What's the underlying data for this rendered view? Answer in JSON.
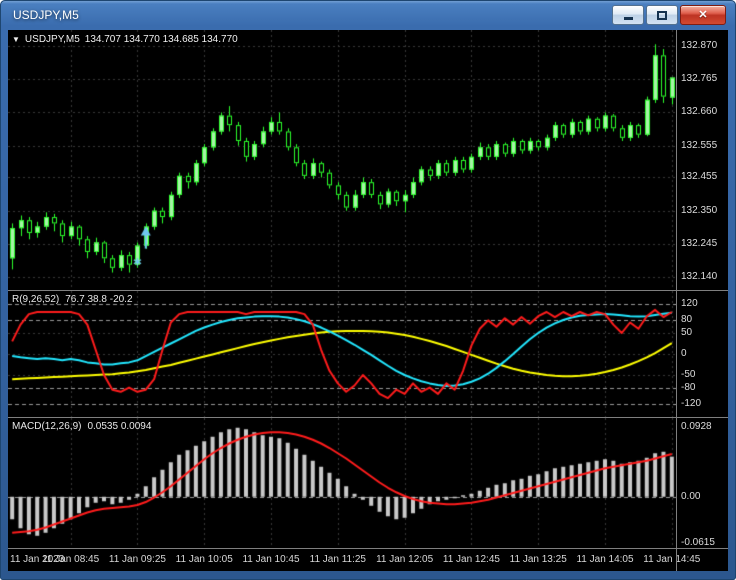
{
  "window": {
    "title": "USDJPY,M5",
    "controls": {
      "close_glyph": "✕"
    }
  },
  "quote_bar": {
    "dropdown_icon": "▼",
    "symbol": "USDJPY,M5",
    "ohlc": "134.707 134.770 134.685 134.770"
  },
  "panels": {
    "price": {
      "scale": [
        "132.870",
        "132.765",
        "132.660",
        "132.555",
        "132.455",
        "132.350",
        "132.245",
        "132.140"
      ]
    },
    "oscillator": {
      "label_name": "R(9,26,52)",
      "label_values": "76.7 38.8 -20.2",
      "scale": [
        "120",
        "80",
        "50",
        "0",
        "-50",
        "-80",
        "-120"
      ]
    },
    "macd": {
      "label_name": "MACD(12,26,9)",
      "label_values": "0.0535 0.0094",
      "scale": [
        "0.0928",
        "0.00",
        "-0.0615"
      ]
    }
  },
  "time_axis": [
    {
      "label": "11 Jan 2023",
      "index": 0
    },
    {
      "label": "11 Jan 08:45",
      "index": 7
    },
    {
      "label": "11 Jan 09:25",
      "index": 15
    },
    {
      "label": "11 Jan 10:05",
      "index": 23
    },
    {
      "label": "11 Jan 10:45",
      "index": 31
    },
    {
      "label": "11 Jan 11:25",
      "index": 39
    },
    {
      "label": "11 Jan 12:05",
      "index": 47
    },
    {
      "label": "11 Jan 12:45",
      "index": 55
    },
    {
      "label": "11 Jan 13:25",
      "index": 63
    },
    {
      "label": "11 Jan 14:05",
      "index": 71
    },
    {
      "label": "11 Jan 14:45",
      "index": 79
    }
  ],
  "colors": {
    "background": "#000000",
    "frame_blue": "#3a6cae",
    "candle_outline": "#2bff2b",
    "bull_fill": "#a7f3a7",
    "bear_fill": "#000000",
    "grid": "#383838",
    "level": "#9a9a9a",
    "separator": "#7f7f7f",
    "axis_text": "#dcdcdc",
    "annotation": "#6fc7f0"
  },
  "chart_data": [
    {
      "type": "candlestick",
      "title": "USDJPY,M5",
      "timeframe": "M5",
      "ylim": [
        132.1,
        132.92
      ],
      "y_ticks": [
        132.87,
        132.765,
        132.66,
        132.555,
        132.455,
        132.35,
        132.245,
        132.14
      ],
      "candles": [
        [
          132.2,
          132.31,
          132.165,
          132.295
        ],
        [
          132.295,
          132.335,
          132.27,
          132.32
        ],
        [
          132.32,
          132.33,
          132.26,
          132.28
        ],
        [
          132.28,
          132.315,
          132.265,
          132.3
        ],
        [
          132.3,
          132.345,
          132.29,
          132.33
        ],
        [
          132.33,
          132.34,
          132.285,
          132.31
        ],
        [
          132.31,
          132.32,
          132.25,
          132.27
        ],
        [
          132.27,
          132.315,
          132.26,
          132.3
        ],
        [
          132.3,
          132.305,
          132.24,
          132.26
        ],
        [
          132.26,
          132.27,
          132.2,
          132.22
        ],
        [
          132.22,
          132.265,
          132.21,
          132.25
        ],
        [
          132.25,
          132.255,
          132.185,
          132.2
        ],
        [
          132.2,
          132.21,
          132.155,
          132.17
        ],
        [
          132.17,
          132.225,
          132.16,
          132.21
        ],
        [
          132.21,
          132.22,
          132.155,
          132.18
        ],
        [
          132.18,
          132.25,
          132.17,
          132.24
        ],
        [
          132.24,
          132.31,
          132.23,
          132.3
        ],
        [
          132.3,
          132.36,
          132.29,
          132.35
        ],
        [
          132.35,
          132.36,
          132.31,
          132.33
        ],
        [
          132.33,
          132.41,
          132.32,
          132.4
        ],
        [
          132.4,
          132.47,
          132.39,
          132.46
        ],
        [
          132.46,
          132.47,
          132.42,
          132.44
        ],
        [
          132.44,
          132.51,
          132.43,
          132.5
        ],
        [
          132.5,
          132.56,
          132.49,
          132.55
        ],
        [
          132.55,
          132.61,
          132.54,
          132.6
        ],
        [
          132.6,
          132.66,
          132.59,
          132.65
        ],
        [
          132.65,
          132.68,
          132.6,
          132.62
        ],
        [
          132.62,
          132.63,
          132.555,
          132.57
        ],
        [
          132.57,
          132.58,
          132.505,
          132.52
        ],
        [
          132.52,
          132.57,
          132.51,
          132.56
        ],
        [
          132.56,
          132.615,
          132.55,
          132.6
        ],
        [
          132.6,
          132.645,
          132.59,
          132.63
        ],
        [
          132.63,
          132.66,
          132.59,
          132.6
        ],
        [
          132.6,
          132.61,
          132.54,
          132.55
        ],
        [
          132.55,
          132.56,
          132.49,
          132.5
        ],
        [
          132.5,
          132.51,
          132.45,
          132.46
        ],
        [
          132.46,
          132.515,
          132.45,
          132.5
        ],
        [
          132.5,
          132.505,
          132.455,
          132.47
        ],
        [
          132.47,
          132.48,
          132.42,
          132.43
        ],
        [
          132.43,
          132.44,
          132.385,
          132.4
        ],
        [
          132.4,
          132.41,
          132.35,
          132.36
        ],
        [
          132.36,
          132.415,
          132.35,
          132.4
        ],
        [
          132.4,
          132.455,
          132.39,
          132.44
        ],
        [
          132.44,
          132.45,
          132.39,
          132.4
        ],
        [
          132.4,
          132.41,
          132.355,
          132.37
        ],
        [
          132.37,
          132.42,
          132.36,
          132.41
        ],
        [
          132.41,
          132.415,
          132.365,
          132.38
        ],
        [
          132.38,
          132.415,
          132.345,
          132.4
        ],
        [
          132.4,
          132.455,
          132.39,
          132.44
        ],
        [
          132.44,
          132.49,
          132.43,
          132.48
        ],
        [
          132.48,
          132.49,
          132.445,
          132.46
        ],
        [
          132.46,
          132.51,
          132.45,
          132.5
        ],
        [
          132.5,
          132.51,
          132.46,
          132.47
        ],
        [
          132.47,
          132.52,
          132.46,
          132.51
        ],
        [
          132.51,
          132.52,
          132.47,
          132.48
        ],
        [
          132.48,
          132.53,
          132.47,
          132.52
        ],
        [
          132.52,
          132.565,
          132.51,
          132.55
        ],
        [
          132.55,
          132.56,
          132.51,
          132.52
        ],
        [
          132.52,
          132.57,
          132.51,
          132.56
        ],
        [
          132.56,
          132.565,
          132.52,
          132.53
        ],
        [
          132.53,
          132.58,
          132.52,
          132.57
        ],
        [
          132.57,
          132.575,
          132.53,
          132.54
        ],
        [
          132.54,
          132.58,
          132.53,
          132.57
        ],
        [
          132.57,
          132.575,
          132.54,
          132.55
        ],
        [
          132.55,
          132.59,
          132.54,
          132.58
        ],
        [
          132.58,
          132.63,
          132.57,
          132.62
        ],
        [
          132.62,
          132.625,
          132.58,
          132.59
        ],
        [
          132.59,
          132.64,
          132.58,
          132.63
        ],
        [
          132.63,
          132.635,
          132.59,
          132.6
        ],
        [
          132.6,
          132.65,
          132.59,
          132.64
        ],
        [
          132.64,
          132.645,
          132.6,
          132.61
        ],
        [
          132.61,
          132.66,
          132.6,
          132.65
        ],
        [
          132.65,
          132.655,
          132.6,
          132.61
        ],
        [
          132.61,
          132.62,
          132.57,
          132.58
        ],
        [
          132.58,
          132.63,
          132.57,
          132.62
        ],
        [
          132.62,
          132.625,
          132.58,
          132.59
        ],
        [
          132.59,
          132.71,
          132.585,
          132.7
        ],
        [
          132.7,
          132.875,
          132.69,
          132.84
        ],
        [
          132.84,
          132.86,
          132.69,
          132.71
        ],
        [
          132.707,
          132.77,
          132.685,
          132.77
        ]
      ],
      "annotations": [
        {
          "type": "up-arrow",
          "index": 16,
          "price": 132.3,
          "color": "#6fc7f0"
        },
        {
          "type": "star",
          "index": 15,
          "price": 132.185,
          "color": "#6fc7f0"
        }
      ]
    },
    {
      "type": "line",
      "title": "R(9,26,52)",
      "ylim": [
        -150,
        150
      ],
      "y_ticks": [
        120,
        80,
        50,
        0,
        -50,
        -80,
        -120
      ],
      "levels": [
        120,
        80,
        -80,
        -120
      ],
      "grid_levels": [
        50,
        0,
        -50
      ],
      "series": [
        {
          "name": "fast",
          "color": "#ff1c1c",
          "values": [
            30,
            70,
            95,
            100,
            100,
            100,
            100,
            100,
            95,
            70,
            10,
            -50,
            -85,
            -90,
            -80,
            -90,
            -85,
            -60,
            10,
            75,
            95,
            100,
            100,
            100,
            100,
            100,
            100,
            100,
            95,
            100,
            100,
            100,
            100,
            100,
            100,
            95,
            70,
            10,
            -40,
            -70,
            -90,
            -75,
            -50,
            -70,
            -95,
            -105,
            -85,
            -95,
            -70,
            -90,
            -80,
            -95,
            -70,
            -85,
            -40,
            20,
            60,
            80,
            65,
            85,
            70,
            88,
            72,
            90,
            100,
            88,
            100,
            90,
            100,
            92,
            100,
            95,
            70,
            50,
            75,
            60,
            90,
            105,
            88,
            100
          ]
        },
        {
          "name": "mid",
          "color": "#22e7ff",
          "values": [
            -5,
            -8,
            -10,
            -12,
            -10,
            -12,
            -15,
            -12,
            -15,
            -20,
            -22,
            -25,
            -25,
            -22,
            -20,
            -15,
            -5,
            5,
            15,
            25,
            35,
            45,
            55,
            63,
            70,
            76,
            81,
            85,
            87,
            89,
            90,
            90,
            89,
            87,
            83,
            78,
            71,
            63,
            54,
            44,
            33,
            22,
            10,
            -2,
            -15,
            -28,
            -40,
            -50,
            -58,
            -65,
            -70,
            -74,
            -76,
            -75,
            -72,
            -66,
            -58,
            -47,
            -33,
            -17,
            0,
            18,
            35,
            50,
            63,
            73,
            81,
            87,
            91,
            93,
            94,
            95,
            94,
            92,
            90,
            89,
            90,
            93,
            96,
            98
          ]
        },
        {
          "name": "slow",
          "color": "#ffff00",
          "values": [
            -60,
            -59,
            -58,
            -57,
            -56,
            -55,
            -54,
            -53,
            -52,
            -51,
            -50,
            -49,
            -48,
            -46,
            -44,
            -41,
            -38,
            -34,
            -30,
            -26,
            -21,
            -16,
            -11,
            -6,
            -1,
            4,
            9,
            14,
            19,
            24,
            28,
            32,
            36,
            40,
            43,
            46,
            49,
            51,
            53,
            54,
            55,
            55,
            55,
            54,
            53,
            51,
            48,
            45,
            41,
            36,
            31,
            25,
            19,
            12,
            5,
            -2,
            -9,
            -16,
            -23,
            -29,
            -35,
            -40,
            -44,
            -47,
            -50,
            -52,
            -53,
            -53,
            -52,
            -50,
            -47,
            -43,
            -38,
            -32,
            -25,
            -17,
            -8,
            2,
            14,
            26
          ]
        }
      ]
    },
    {
      "type": "macd",
      "title": "MACD(12,26,9)",
      "ylim": [
        -0.0683,
        0.105
      ],
      "y_ticks": [
        0.0928,
        0.0,
        -0.0615
      ],
      "levels": [
        0
      ],
      "histogram": {
        "color": "#c9c9c9",
        "values": [
          -0.03,
          -0.042,
          -0.05,
          -0.052,
          -0.048,
          -0.042,
          -0.036,
          -0.03,
          -0.022,
          -0.014,
          -0.008,
          -0.006,
          -0.01,
          -0.008,
          -0.004,
          0.004,
          0.014,
          0.026,
          0.036,
          0.046,
          0.056,
          0.062,
          0.068,
          0.074,
          0.08,
          0.086,
          0.09,
          0.092,
          0.09,
          0.086,
          0.082,
          0.08,
          0.078,
          0.072,
          0.064,
          0.056,
          0.048,
          0.04,
          0.032,
          0.024,
          0.014,
          0.004,
          -0.004,
          -0.012,
          -0.02,
          -0.026,
          -0.03,
          -0.028,
          -0.022,
          -0.016,
          -0.01,
          -0.006,
          -0.004,
          -0.002,
          0.002,
          0.004,
          0.008,
          0.012,
          0.016,
          0.018,
          0.022,
          0.024,
          0.028,
          0.03,
          0.034,
          0.038,
          0.04,
          0.042,
          0.044,
          0.046,
          0.048,
          0.05,
          0.048,
          0.044,
          0.046,
          0.048,
          0.052,
          0.058,
          0.06,
          0.0535
        ]
      },
      "signal": {
        "color": "#ff1c1c",
        "values": [
          -0.048,
          -0.047,
          -0.046,
          -0.044,
          -0.041,
          -0.037,
          -0.033,
          -0.029,
          -0.025,
          -0.021,
          -0.018,
          -0.016,
          -0.015,
          -0.014,
          -0.013,
          -0.011,
          -0.007,
          -0.001,
          0.006,
          0.014,
          0.023,
          0.032,
          0.041,
          0.05,
          0.058,
          0.065,
          0.071,
          0.076,
          0.08,
          0.083,
          0.085,
          0.086,
          0.086,
          0.085,
          0.083,
          0.08,
          0.076,
          0.071,
          0.065,
          0.058,
          0.051,
          0.043,
          0.035,
          0.027,
          0.019,
          0.012,
          0.006,
          0.001,
          -0.003,
          -0.006,
          -0.008,
          -0.009,
          -0.01,
          -0.01,
          -0.009,
          -0.008,
          -0.006,
          -0.004,
          -0.001,
          0.002,
          0.005,
          0.008,
          0.011,
          0.014,
          0.017,
          0.02,
          0.023,
          0.026,
          0.029,
          0.032,
          0.035,
          0.038,
          0.04,
          0.042,
          0.044,
          0.046,
          0.048,
          0.051,
          0.054,
          0.057
        ]
      }
    }
  ]
}
